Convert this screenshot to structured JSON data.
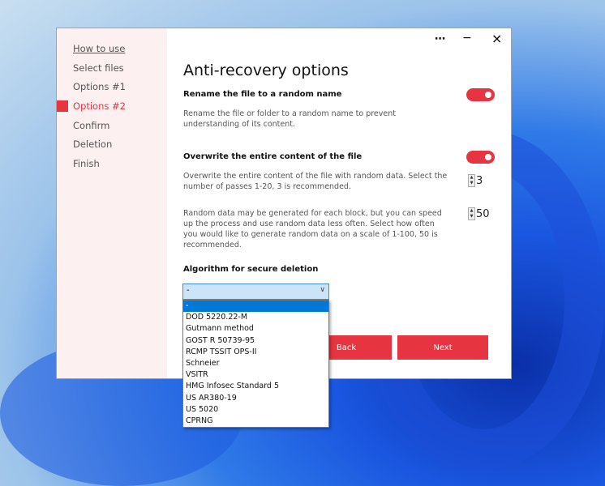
{
  "window": {
    "more_icon": "⋯",
    "minimize_icon": "−",
    "close_icon": "×"
  },
  "sidebar": {
    "items": [
      {
        "label": "How to use"
      },
      {
        "label": "Select files"
      },
      {
        "label": "Options #1"
      },
      {
        "label": "Options #2"
      },
      {
        "label": "Confirm"
      },
      {
        "label": "Deletion"
      },
      {
        "label": "Finish"
      }
    ],
    "active_index": 3
  },
  "main": {
    "title": "Anti-recovery options",
    "rename": {
      "heading": "Rename the file to a random name",
      "description": "Rename the file or folder to a random name to prevent understanding of its content.",
      "enabled": true
    },
    "overwrite": {
      "heading": "Overwrite the entire content of the file",
      "description": "Overwrite the entire content of the file with random data. Select the number of passes 1-20, 3 is recommended.",
      "enabled": true,
      "passes": "3"
    },
    "random": {
      "description": "Random data may be generated for each block, but you can speed up the process and use random data less often. Select how often you would like to generate random data on a scale of 1-100, 50 is recommended.",
      "value": "50"
    },
    "algorithm": {
      "heading": "Algorithm for secure deletion",
      "selected": "-",
      "options": [
        "-",
        "DOD 5220.22-M",
        "Gutmann method",
        "GOST R 50739-95",
        "RCMP TSSIT OPS-II",
        "Schneier",
        "VSITR",
        "HMG Infosec Standard 5",
        "US AR380-19",
        "US 5020",
        "CPRNG"
      ]
    },
    "back_label": "Back",
    "next_label": "Next"
  },
  "colors": {
    "accent": "#e63540",
    "sidebar_bg": "#fdf0f0",
    "selection": "#0078d7"
  }
}
